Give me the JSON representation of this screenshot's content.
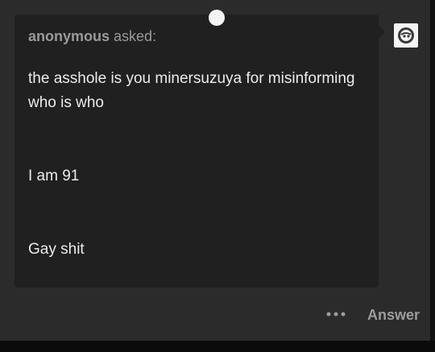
{
  "ask": {
    "asker_name": "anonymous",
    "asked_label": "asked:",
    "paragraphs": [
      "the asshole is you minersuzuya for misinforming who is who",
      "I am 91",
      "Gay shit"
    ]
  },
  "actions": {
    "more_icon": "more-dots-icon",
    "answer_label": "Answer"
  },
  "avatar": {
    "icon": "blog-avatar-icon"
  },
  "colors": {
    "background": "#2b2b2b",
    "card": "#202020",
    "muted_text": "#9a9a9a",
    "body_text": "#ececec"
  }
}
